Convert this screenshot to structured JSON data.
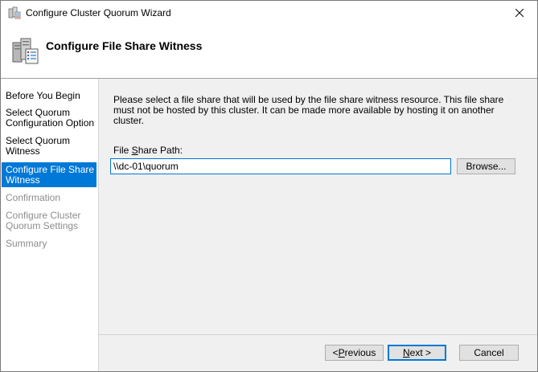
{
  "window": {
    "title": "Configure Cluster Quorum Wizard"
  },
  "header": {
    "title": "Configure File Share Witness",
    "icon": "cluster-server-icon"
  },
  "nav": {
    "items": [
      {
        "label": "Before You Begin",
        "state": "normal"
      },
      {
        "label": "Select Quorum Configuration Option",
        "state": "normal"
      },
      {
        "label": "Select Quorum Witness",
        "state": "normal"
      },
      {
        "label": "Configure File Share Witness",
        "state": "active"
      },
      {
        "label": "Confirmation",
        "state": "disabled"
      },
      {
        "label": "Configure Cluster Quorum Settings",
        "state": "disabled"
      },
      {
        "label": "Summary",
        "state": "disabled"
      }
    ]
  },
  "content": {
    "description": "Please select a file share that will be used by the file share witness resource.  This file share must not be hosted by this cluster.  It can be made more available by hosting it on another cluster.",
    "path_label_pre": "File ",
    "path_label_accel": "S",
    "path_label_post": "hare Path:",
    "path_value": "\\\\dc-01\\quorum",
    "browse_label": "Browse..."
  },
  "footer": {
    "previous_accel": "P",
    "previous_pre": "< ",
    "previous_post": "revious",
    "next_accel": "N",
    "next_post": "ext >",
    "cancel_label": "Cancel"
  },
  "colors": {
    "accent": "#0078d7",
    "panel": "#f0f0f0",
    "disabled_text": "#8c8c8c"
  }
}
